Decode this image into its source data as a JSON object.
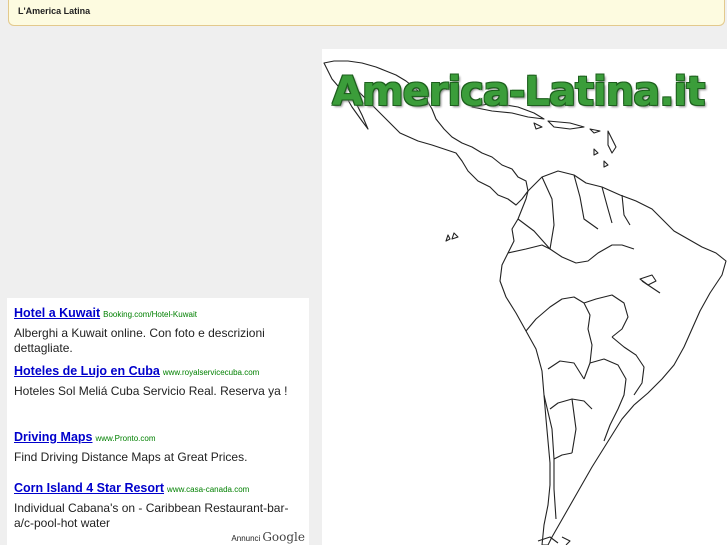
{
  "header": {
    "title": "L'America Latina"
  },
  "ads": {
    "items": [
      {
        "title": "Hotel a Kuwait",
        "url": "Booking.com/Hotel-Kuwait",
        "desc": "Alberghi a Kuwait online. Con foto e descrizioni dettagliate."
      },
      {
        "title": "Hoteles de Lujo en Cuba",
        "url": "www.royalservicecuba.com",
        "desc": "Hoteles Sol Meliá Cuba Servicio Real. Reserva ya !"
      },
      {
        "title": "Driving Maps",
        "url": "www.Pronto.com",
        "desc": "Find Driving Distance Maps at Great Prices."
      },
      {
        "title": "Corn Island 4 Star Resort",
        "url": "www.casa-canada.com",
        "desc": "Individual Cabana's on - Caribbean Restaurant-bar-a/c-pool-hot water"
      }
    ],
    "annunci_label": "Annunci",
    "google_label": "Google"
  },
  "map": {
    "logo_text": "America-Latina.it",
    "icon": "latin-america-outline-map",
    "logo_color": "#3b9d3a"
  }
}
